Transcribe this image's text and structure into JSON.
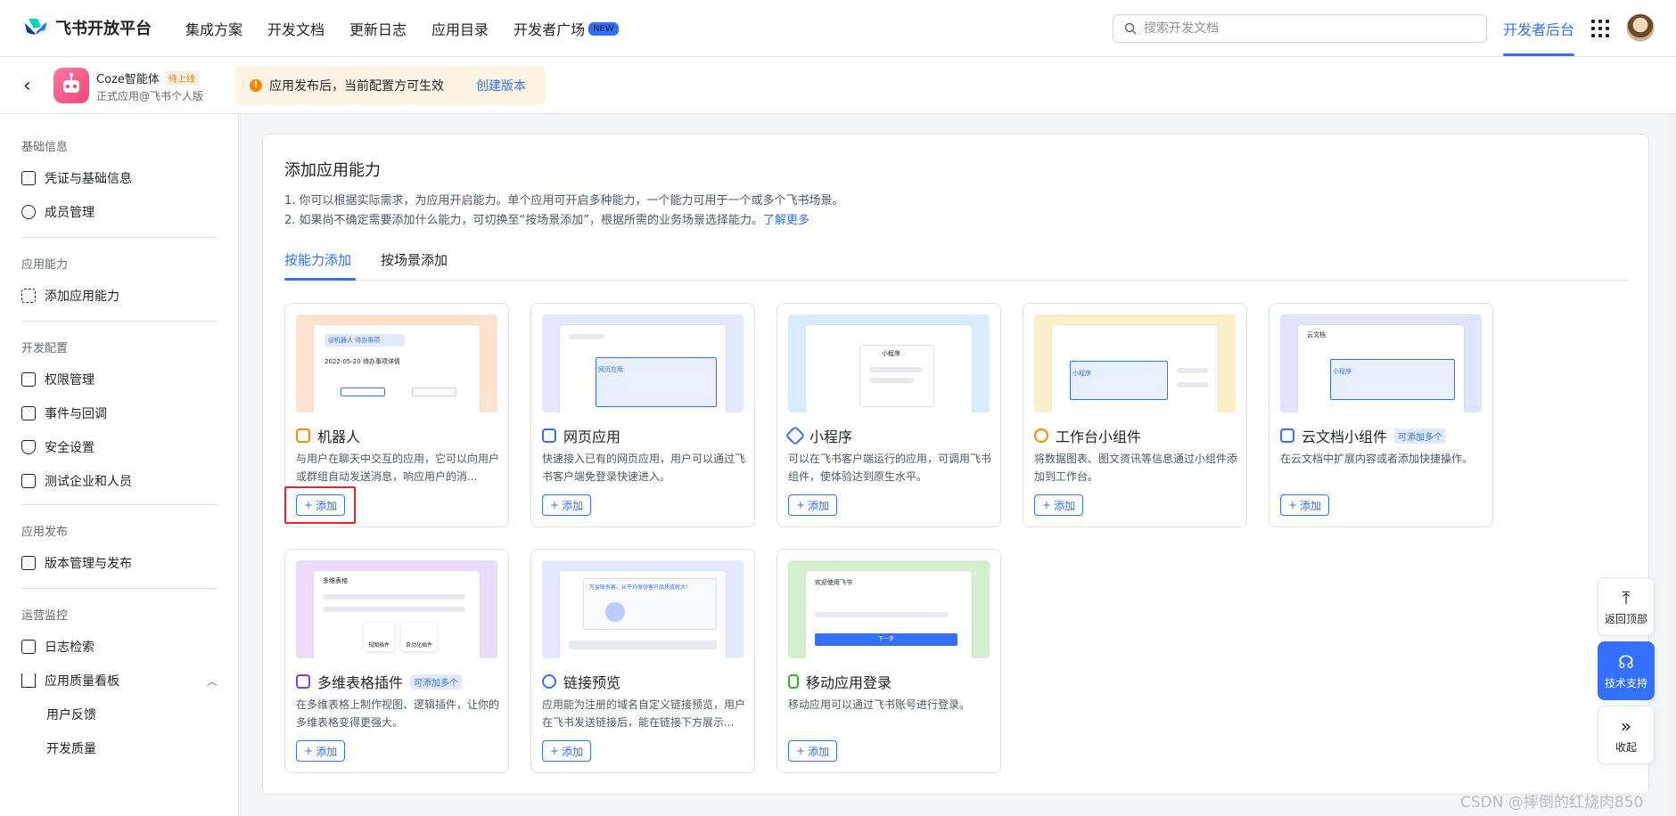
{
  "brand": {
    "name": "飞书开放平台"
  },
  "nav": {
    "items": [
      "集成方案",
      "开发文档",
      "更新日志",
      "应用目录"
    ],
    "plaza": "开发者广场",
    "plaza_badge": "NEW"
  },
  "search": {
    "placeholder": "搜索开发文档"
  },
  "header": {
    "dev_backend": "开发者后台"
  },
  "app": {
    "name": "Coze智能体",
    "status": "待上线",
    "sub": "正式应用@飞书个人版"
  },
  "notice": {
    "text": "应用发布后，当前配置方可生效",
    "action": "创建版本"
  },
  "sidebar": {
    "sections": [
      {
        "title": "基础信息",
        "items": [
          "凭证与基础信息",
          "成员管理"
        ]
      },
      {
        "title": "应用能力",
        "items": [
          "添加应用能力"
        ]
      },
      {
        "title": "开发配置",
        "items": [
          "权限管理",
          "事件与回调",
          "安全设置",
          "测试企业和人员"
        ]
      },
      {
        "title": "应用发布",
        "items": [
          "版本管理与发布"
        ]
      },
      {
        "title": "运营监控",
        "items": [
          "日志检索",
          "应用质量看板"
        ],
        "sub_items": [
          "用户反馈",
          "开发质量"
        ]
      }
    ]
  },
  "main": {
    "title": "添加应用能力",
    "desc1": "1. 你可以根据实际需求，为应用开启能力。单个应用可开启多种能力，一个能力可用于一个或多个飞书场景。",
    "desc2": "2. 如果尚不确定需要添加什么能力，可切换至“按场景添加”，根据所需的业务场景选择能力。",
    "desc2_link": "了解更多",
    "tabs": [
      "按能力添加",
      "按场景添加"
    ]
  },
  "cards": [
    {
      "title": "机器人",
      "desc": "与用户在聊天中交互的应用，它可以向用户或群组自动发送消息，响应用户的消...",
      "add": "添加",
      "color": "#ff8800",
      "bg": "#fde3cf",
      "thumb_text": "2022-05-20 待办事项详情",
      "thumb_label": "@机器人 待办事项"
    },
    {
      "title": "网页应用",
      "desc": "快速接入已有的网页应用，用户可以通过飞书客户端免登录快速进入。",
      "add": "添加",
      "color": "#3370ff",
      "bg": "#e1e8ff",
      "thumb_text": "网页应用"
    },
    {
      "title": "小程序",
      "desc": "可以在飞书客户端运行的应用，可调用飞书组件，使体验达到原生水平。",
      "add": "添加",
      "color": "#3370ff",
      "bg": "#d8ecff",
      "thumb_text": "小程序"
    },
    {
      "title": "工作台小组件",
      "desc": "将数据图表、图文资讯等信息通过小组件添加到工作台。",
      "add": "添加",
      "color": "#ff8800",
      "bg": "#fbefc9",
      "thumb_text": "小程序"
    },
    {
      "title": "云文档小组件",
      "badge": "可添加多个",
      "desc": "在云文档中扩展内容或者添加快捷操作。",
      "add": "添加",
      "color": "#3370ff",
      "bg": "#dfe3fb",
      "thumb_text": "小程序",
      "thumb_title": "云文档"
    },
    {
      "title": "多维表格插件",
      "badge": "可添加多个",
      "desc": "在多维表格上制作视图、逻辑插件，让你的多维表格变得更强大。",
      "add": "添加",
      "color": "#7f3bf5",
      "bg": "#eadcfb",
      "thumb_title": "多维表格",
      "thumb_a": "视图插件",
      "thumb_b": "自动化插件"
    },
    {
      "title": "链接预览",
      "desc": "应用能为注册的域名自定义链接预览，用户在飞书发送链接后，能在链接下方展示...",
      "add": "添加",
      "color": "#3370ff",
      "bg": "#e1e8ff",
      "thumb_text": "万益联系客，从平均身份客户品质成就大!"
    },
    {
      "title": "移动应用登录",
      "desc": "移动应用可以通过飞书账号进行登录。",
      "add": "添加",
      "color": "#34b233",
      "bg": "#d4efce",
      "thumb_title": "欢迎使用飞书",
      "thumb_btn": "下一步"
    }
  ],
  "float": {
    "top": "返回顶部",
    "support": "技术支持",
    "collapse": "收起"
  },
  "watermark": "CSDN @摔倒的红烧肉850"
}
